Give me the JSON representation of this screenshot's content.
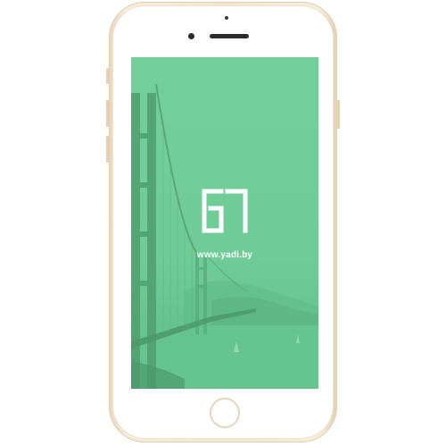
{
  "device": {
    "model_color": "#f3e6d2"
  },
  "screen": {
    "overlay_color": "#6fcc95",
    "logo_icon": "yadi-logo-icon",
    "url_text": "www.yadi.by"
  },
  "icons": {
    "home": "home-button-ring",
    "camera": "front-camera-dot",
    "speaker": "earpiece-slot"
  }
}
